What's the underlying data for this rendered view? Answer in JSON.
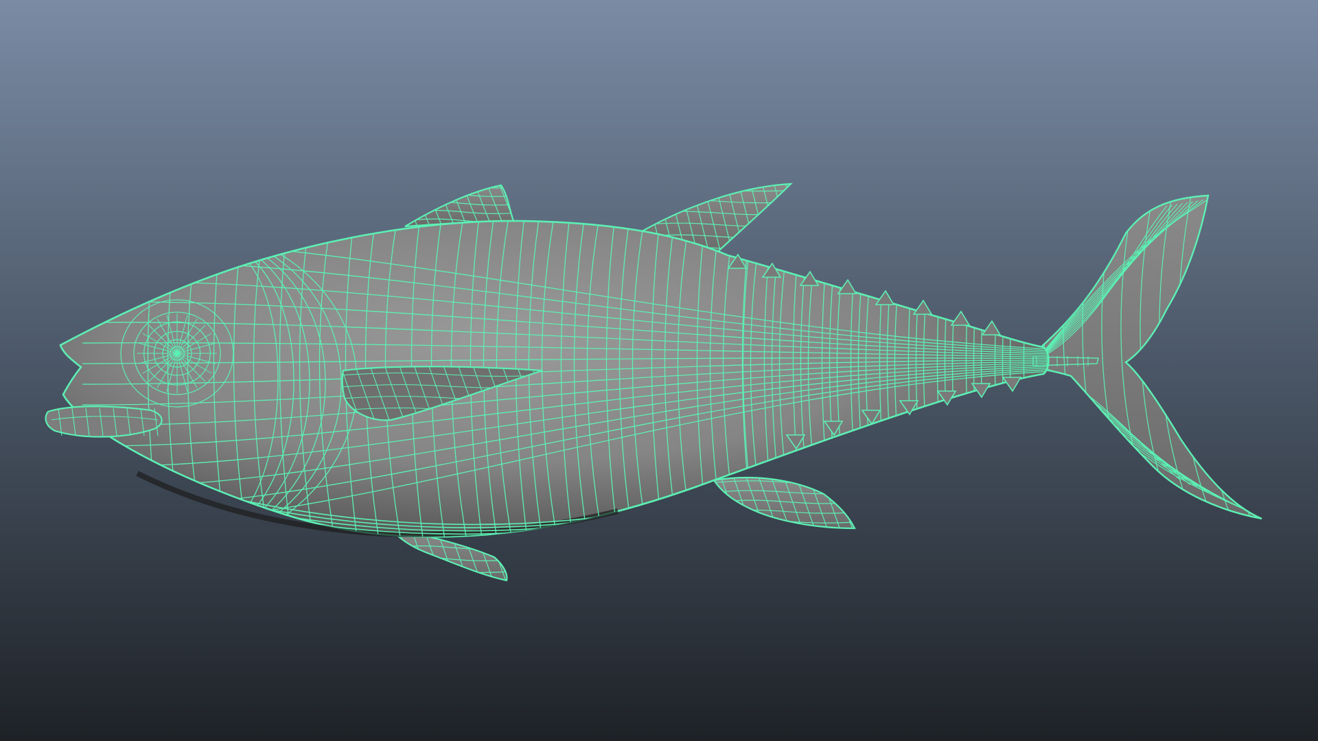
{
  "viewport": {
    "background_top": "#7a8ba4",
    "background_bottom": "#1e2227",
    "mesh_color": "#5cf0b4",
    "surface_color": "#8e8e8e",
    "surface_shadow": "#3c3c3c"
  },
  "model": {
    "subject": "tuna",
    "display_mode": "wireframe-on-shaded"
  }
}
